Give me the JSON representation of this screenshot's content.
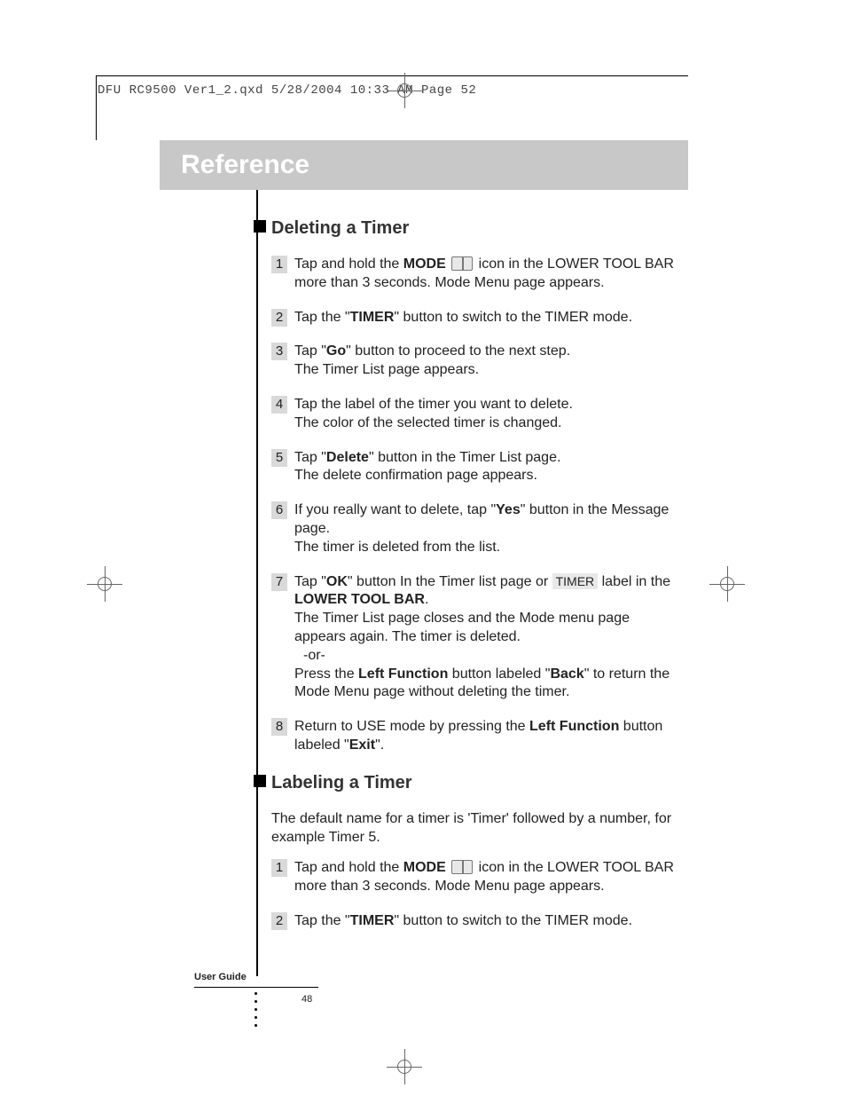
{
  "meta": {
    "file_header": "DFU RC9500 Ver1_2.qxd  5/28/2004  10:33 AM  Page 52",
    "title": "Reference",
    "footer_label": "User Guide",
    "page_number": "48"
  },
  "labels": {
    "timer_box": "TIMER"
  },
  "sections": {
    "deleting": {
      "heading": "Deleting a Timer",
      "steps": {
        "s1a": "Tap and hold the ",
        "s1_mode": "MODE",
        "s1b": " icon in the LOWER TOOL BAR more than 3 seconds. Mode Menu page appears.",
        "s2a": "Tap the \"",
        "s2_timer": "TIMER",
        "s2b": "\" button to switch to the TIMER mode.",
        "s3a": "Tap \"",
        "s3_go": "Go",
        "s3b": "\" button to proceed to the next step.",
        "s3c": "The Timer List page appears.",
        "s4a": "Tap the label of the timer you want to delete.",
        "s4b": "The color of the selected timer is changed.",
        "s5a": "Tap \"",
        "s5_delete": "Delete",
        "s5b": "\" button in the Timer List page.",
        "s5c": "The delete confirmation page appears.",
        "s6a": "If you really want to delete, tap \"",
        "s6_yes": "Yes",
        "s6b": "\" button in the Message page.",
        "s6c": "The timer is deleted from the list.",
        "s7a": "Tap \"",
        "s7_ok": "OK",
        "s7b": "\" button In the Timer list page or ",
        "s7c": " label in the ",
        "s7_ltb": "LOWER TOOL BAR",
        "s7d": ".",
        "s7e": "The Timer List page closes and the Mode menu page appears again. The timer is deleted.",
        "s7_or": "-or-",
        "s7f": "Press the ",
        "s7_lf": "Left Function",
        "s7g": " button labeled \"",
        "s7_back": "Back",
        "s7h": "\" to return the Mode Menu page without deleting the timer.",
        "s8a": "Return to USE mode by pressing the ",
        "s8_lf": "Left Function",
        "s8b": " button labeled \"",
        "s8_exit": "Exit",
        "s8c": "\"."
      }
    },
    "labeling": {
      "heading": "Labeling a Timer",
      "intro": "The default name for a timer is 'Timer' followed by a number, for example Timer 5.",
      "steps": {
        "s1a": "Tap and hold the ",
        "s1_mode": "MODE",
        "s1b": " icon in the LOWER TOOL BAR more than 3 seconds. Mode Menu page appears.",
        "s2a": "Tap the \"",
        "s2_timer": "TIMER",
        "s2b": "\" button to switch to the TIMER mode."
      }
    }
  }
}
